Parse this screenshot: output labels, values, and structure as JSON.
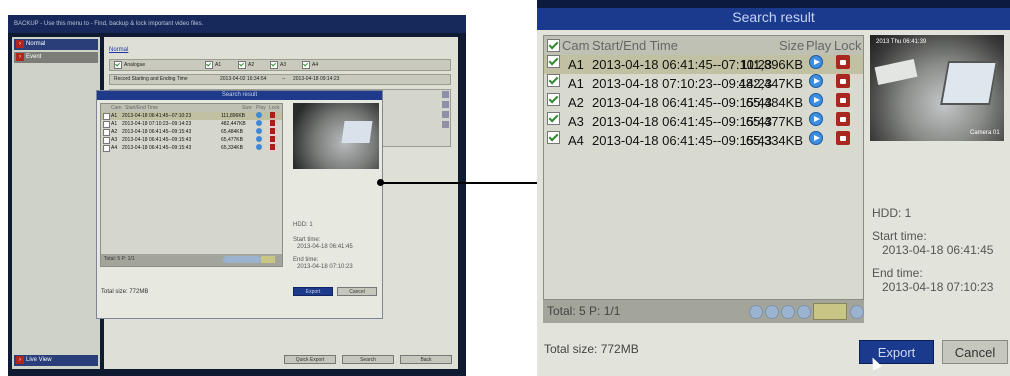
{
  "left": {
    "title_bar": "BACKUP - Use this menu to - Find, backup & lock important video files.",
    "sidebar": [
      "Normal",
      "Event"
    ],
    "sidebar_bottom": "Live View",
    "section_link": "Normal",
    "analogue_label": "Analogue",
    "cams": [
      "A1",
      "A2",
      "A3",
      "A4"
    ],
    "record_label": "Record Starting and Ending Time",
    "record_start": "2013-04-02 16:34:54",
    "record_sep": "--",
    "record_end": "2013-04-18 09:14:23",
    "buttons": [
      "Quick Export",
      "Search",
      "Back"
    ]
  },
  "dialog": {
    "title": "Search result",
    "headers": {
      "cam": "Cam",
      "time": "Start/End Time",
      "size": "Size",
      "play": "Play",
      "lock": "Lock"
    },
    "rows": [
      {
        "cam": "A1",
        "time": "2013-04-18 06:41:45--07:10:23",
        "size": "111,896KB"
      },
      {
        "cam": "A1",
        "time": "2013-04-18 07:10:23--09:14:23",
        "size": "482,447KB"
      },
      {
        "cam": "A2",
        "time": "2013-04-18 06:41:45--09:15:43",
        "size": "65,484KB"
      },
      {
        "cam": "A3",
        "time": "2013-04-18 06:41:45--09:15:43",
        "size": "65,477KB"
      },
      {
        "cam": "A4",
        "time": "2013-04-18 06:41:45--09:15:43",
        "size": "65,334KB"
      }
    ],
    "hdd": "HDD: 1",
    "start_label": "Start time:",
    "start_value": "2013-04-18 06:41:45",
    "end_label": "End time:",
    "end_value": "2013-04-18 07:10:23",
    "total": "Total: 5  P: 1/1",
    "total_size": "Total size: 772MB",
    "export": "Export",
    "cancel": "Cancel",
    "cam_overlay_ts": "2013 Thu 06:41:39",
    "cam_overlay_name": "Camera 01"
  },
  "colors": {
    "accent": "#1a3a8d",
    "selected_row": "#c2c0a2",
    "lock": "#a9271e",
    "play": "#3c8ddf"
  }
}
